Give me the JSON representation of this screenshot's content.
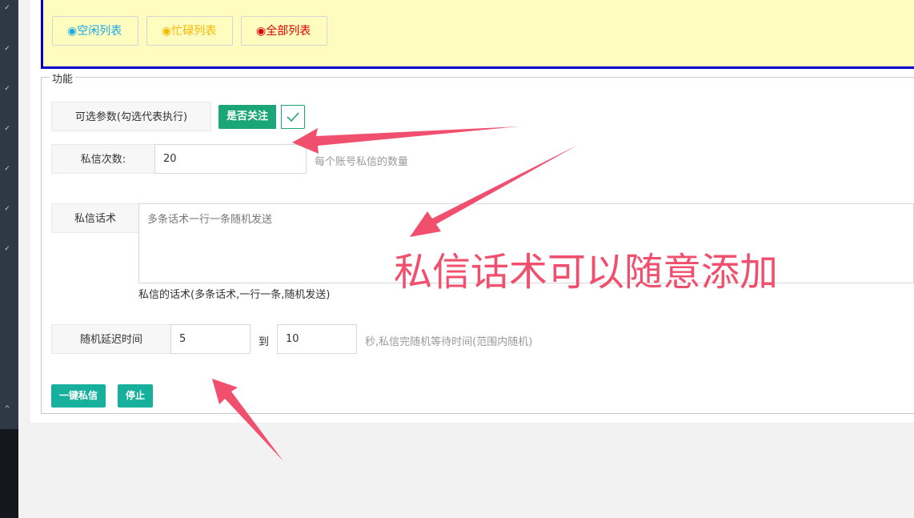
{
  "list_buttons": [
    {
      "label": "◉空闲列表",
      "color": "#1aa7e8"
    },
    {
      "label": "◉忙碌列表",
      "color": "#f5b800"
    },
    {
      "label": "◉全部列表",
      "color": "#e00000"
    }
  ],
  "fieldset": {
    "legend": "功能"
  },
  "optional_params": {
    "label": "可选参数(勾选代表执行)",
    "follow_label": "是否关注",
    "follow_checked": true
  },
  "message_count": {
    "label": "私信次数:",
    "value": "20",
    "hint": "每个账号私信的数量"
  },
  "message_script": {
    "label": "私信话术",
    "placeholder": "多条话术一行一条随机发送",
    "note": "私信的话术(多条话术,一行一条,随机发送)"
  },
  "random_delay": {
    "label": "随机延迟时间",
    "from": "5",
    "to_label": "到",
    "to": "10",
    "hint": "秒,私信完随机等待时间(范围内随机)"
  },
  "actions": {
    "send_label": "一键私信",
    "stop_label": "停止"
  },
  "annotation": {
    "text": "私信话术可以随意添加",
    "color": "#f0506e"
  },
  "theme": {
    "accent_green": "#1aa676",
    "accent_teal": "#16b09d",
    "panel_border": "#0000c6",
    "panel_bg": "#fffcc0"
  }
}
